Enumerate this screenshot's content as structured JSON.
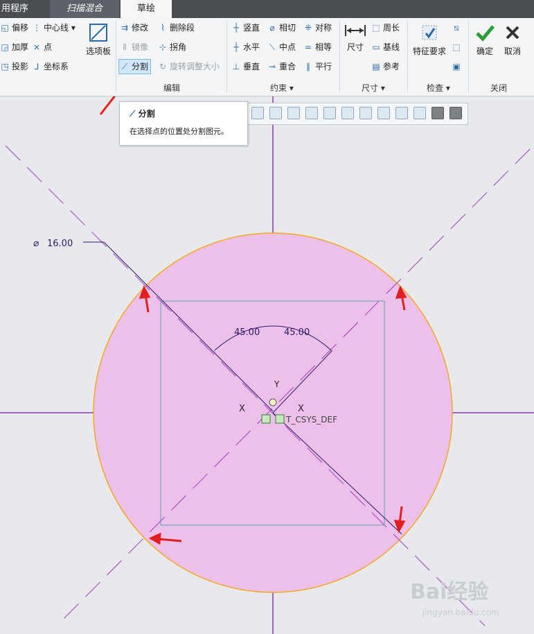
{
  "tabs": [
    "用程序",
    "扫描混合",
    "草绘"
  ],
  "ribbon": {
    "edit_col1": [
      "偏移",
      "加厚",
      "投影"
    ],
    "edit_col2": [
      "中心线",
      "点",
      "坐标系"
    ],
    "palette": "选项板",
    "edit_col3": [
      "修改",
      "镜像",
      "分割"
    ],
    "edit_col4": [
      "删除段",
      "拐角",
      "旋转调整大小"
    ],
    "group_edit": "编辑",
    "cons_col1": [
      "竖直",
      "水平",
      "垂直"
    ],
    "cons_col2": [
      "相切",
      "中点",
      "重合"
    ],
    "cons_col3": [
      "对称",
      "相等",
      "平行"
    ],
    "group_constraint": "约束",
    "dim_btn": "尺寸",
    "dim_col": [
      "周长",
      "基线",
      "参考"
    ],
    "group_dimension": "尺寸",
    "feature_req": "特征要求",
    "group_inspect": "检查",
    "ok": "确定",
    "cancel": "取消",
    "group_close": "关闭"
  },
  "tooltip": {
    "title": "分割",
    "desc": "在选择点的位置处分割图元。"
  },
  "sketch": {
    "diameter": "16.00",
    "angle_left": "45.00",
    "angle_right": "45.00",
    "x_label_left": "X",
    "x_label_right": "X",
    "y_label": "Y",
    "csys_label": "T_CSYS_DEF",
    "circle_fill": "#ecc0e9",
    "circle_stroke": "#f5a623"
  },
  "watermark": {
    "main": "Bai经验",
    "sub": "jingyan.baidu.com"
  }
}
